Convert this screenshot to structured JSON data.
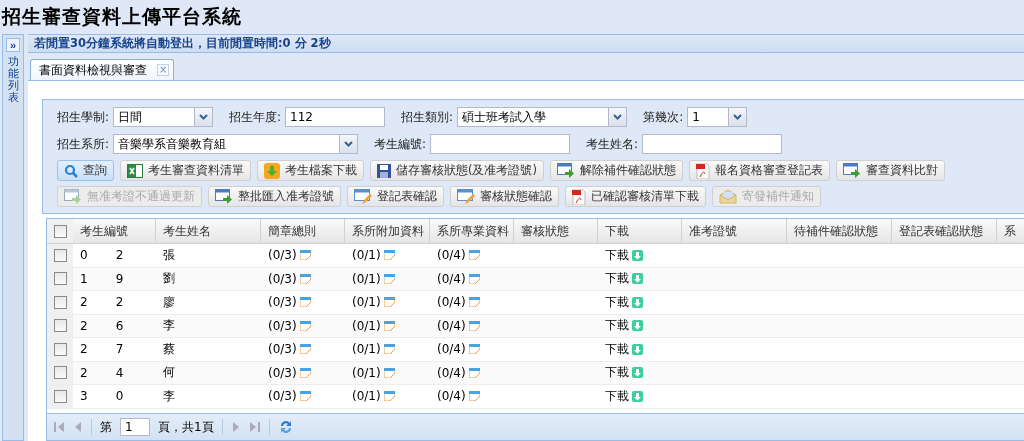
{
  "app_title": "招生審查資料上傳平台系統",
  "sidebar": {
    "toggle": "»",
    "label": "功能列表"
  },
  "idle_notice": "若閒置30分鐘系統將自動登出，目前閒置時間:0 分 2秒",
  "tabs": [
    {
      "label": "書面資料檢視與審查",
      "selected": true,
      "close": "×"
    }
  ],
  "form_rows": [
    [
      {
        "label": "招生學制:",
        "kind": "combo",
        "value": "日間"
      },
      {
        "label": "招生年度:",
        "kind": "text",
        "value": "112"
      },
      {
        "label": "招生類別:",
        "kind": "combo",
        "value": "碩士班考試入學"
      },
      {
        "label": "第幾次:",
        "kind": "combo",
        "value": "1"
      }
    ],
    [
      {
        "label": "招生系所:",
        "kind": "combo",
        "value": "音樂學系音樂教育組"
      },
      {
        "label": "考生編號:",
        "kind": "text"
      },
      {
        "label": "考生姓名:",
        "kind": "text"
      }
    ]
  ],
  "button_rows": [
    [
      {
        "label": "查詢",
        "kind": "search",
        "disabled": false,
        "highlighted": true
      },
      {
        "label": "考生審查資料清單",
        "kind": "excel",
        "disabled": false,
        "highlighted": false
      },
      {
        "label": "考生檔案下載",
        "kind": "download",
        "disabled": false,
        "highlighted": false
      },
      {
        "label": "儲存審核狀態(及准考證號)",
        "kind": "save",
        "disabled": false,
        "highlighted": false
      },
      {
        "label": "解除補件確認狀態",
        "kind": "window",
        "disabled": false,
        "highlighted": false
      },
      {
        "label": "報名資格審查登記表",
        "kind": "pdf",
        "disabled": false,
        "highlighted": false
      },
      {
        "label": "審查資料比對",
        "kind": "window",
        "disabled": false,
        "highlighted": false
      }
    ],
    [
      {
        "label": "無准考證不通過更新",
        "kind": "window",
        "disabled": true,
        "highlighted": false
      },
      {
        "label": "整批匯入准考證號",
        "kind": "window",
        "disabled": false,
        "highlighted": false
      },
      {
        "label": "登記表確認",
        "kind": "edit",
        "disabled": false,
        "highlighted": false
      },
      {
        "label": "審核狀態確認",
        "kind": "edit",
        "disabled": false,
        "highlighted": false
      },
      {
        "label": "已確認審核清單下載",
        "kind": "pdf",
        "disabled": false,
        "highlighted": false
      },
      {
        "label": "寄發補件通知",
        "kind": "mail",
        "disabled": true,
        "highlighted": false
      }
    ]
  ],
  "table": {
    "columns": [
      "考生編號",
      "考生姓名",
      "簡章總則",
      "系所附加資料",
      "系所專業資料",
      "審核狀態",
      "下載",
      "准考證號",
      "待補件確認狀態",
      "登記表確認狀態",
      "系"
    ],
    "all_checked": false,
    "rows": [
      {
        "checked": false,
        "id_head": "0",
        "id_tail": "2",
        "name": "張",
        "general": "(0/3)",
        "dept_extra": "(0/1)",
        "dept_pro": "(0/4)",
        "download": "下載"
      },
      {
        "checked": false,
        "id_head": "1",
        "id_tail": "9",
        "name": "劉",
        "general": "(0/3)",
        "dept_extra": "(0/1)",
        "dept_pro": "(0/4)",
        "download": "下載"
      },
      {
        "checked": false,
        "id_head": "2",
        "id_tail": "2",
        "name": "廖",
        "general": "(0/3)",
        "dept_extra": "(0/1)",
        "dept_pro": "(0/4)",
        "download": "下載"
      },
      {
        "checked": false,
        "id_head": "2",
        "id_tail": "6",
        "name": "李",
        "general": "(0/3)",
        "dept_extra": "(0/1)",
        "dept_pro": "(0/4)",
        "download": "下載"
      },
      {
        "checked": false,
        "id_head": "2",
        "id_tail": "7",
        "name": "蔡",
        "general": "(0/3)",
        "dept_extra": "(0/1)",
        "dept_pro": "(0/4)",
        "download": "下載"
      },
      {
        "checked": false,
        "id_head": "2",
        "id_tail": "4",
        "name": "何",
        "general": "(0/3)",
        "dept_extra": "(0/1)",
        "dept_pro": "(0/4)",
        "download": "下載"
      },
      {
        "checked": false,
        "id_head": "3",
        "id_tail": "0",
        "name": "李",
        "general": "(0/3)",
        "dept_extra": "(0/1)",
        "dept_pro": "(0/4)",
        "download": "下載"
      }
    ]
  },
  "pager": {
    "page_prefix": "第",
    "page": "1",
    "page_suffix": "頁，共1頁"
  }
}
